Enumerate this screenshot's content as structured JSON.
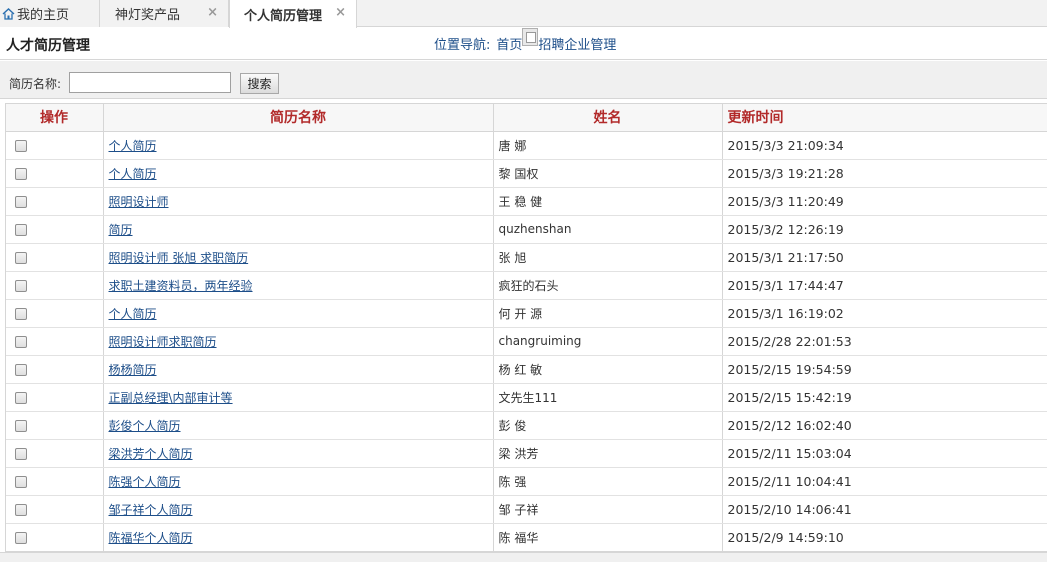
{
  "tabs": [
    {
      "label": "我的主页",
      "icon": "home-icon",
      "closable": false,
      "active": false
    },
    {
      "label": "神灯奖产品",
      "closable": true,
      "active": false
    },
    {
      "label": "个人简历管理",
      "closable": true,
      "active": true
    }
  ],
  "tab_close_glyph": "×",
  "header": {
    "title": "人才简历管理",
    "breadcrumb_prefix": "位置导航:",
    "breadcrumb_home": "首页",
    "breadcrumb_current": "招聘企业管理"
  },
  "search": {
    "label": "简历名称:",
    "value": "",
    "placeholder": "",
    "button_label": "搜索"
  },
  "table": {
    "columns": [
      "操作",
      "简历名称",
      "姓名",
      "更新时间"
    ],
    "rows": [
      {
        "name": "个人简历",
        "person": "唐 娜",
        "time": "2015/3/3 21:09:34"
      },
      {
        "name": "个人简历",
        "person": "黎 国权",
        "time": "2015/3/3 19:21:28"
      },
      {
        "name": "照明设计师",
        "person": "王 稳 健",
        "time": "2015/3/3 11:20:49"
      },
      {
        "name": "简历",
        "person": "quzhenshan",
        "time": "2015/3/2 12:26:19"
      },
      {
        "name": "照明设计师 张旭 求职简历",
        "person": "张 旭",
        "time": "2015/3/1 21:17:50"
      },
      {
        "name": "求职土建资料员，两年经验",
        "person": "疯狂的石头",
        "time": "2015/3/1 17:44:47"
      },
      {
        "name": "个人简历",
        "person": "何 开 源",
        "time": "2015/3/1 16:19:02"
      },
      {
        "name": "照明设计师求职简历",
        "person": "changruiming",
        "time": "2015/2/28 22:01:53"
      },
      {
        "name": "杨杨简历",
        "person": "杨 红 敏",
        "time": "2015/2/15 19:54:59"
      },
      {
        "name": "正副总经理\\内部审计等",
        "person": "文先生111",
        "time": "2015/2/15 15:42:19"
      },
      {
        "name": "彭俊个人简历",
        "person": "彭 俊",
        "time": "2015/2/12 16:02:40"
      },
      {
        "name": "梁洪芳个人简历",
        "person": "梁 洪芳",
        "time": "2015/2/11 15:03:04"
      },
      {
        "name": "陈强个人简历",
        "person": "陈 强",
        "time": "2015/2/11 10:04:41"
      },
      {
        "name": "邹子祥个人简历",
        "person": "邹 子祥",
        "time": "2015/2/10 14:06:41"
      },
      {
        "name": "陈福华个人简历",
        "person": "陈 福华",
        "time": "2015/2/9 14:59:10"
      }
    ]
  },
  "colors": {
    "header_text": "#b22a2a",
    "link": "#1d4e89",
    "toolbar_bg": "#f0f0f0",
    "border": "#d6d6d6"
  }
}
